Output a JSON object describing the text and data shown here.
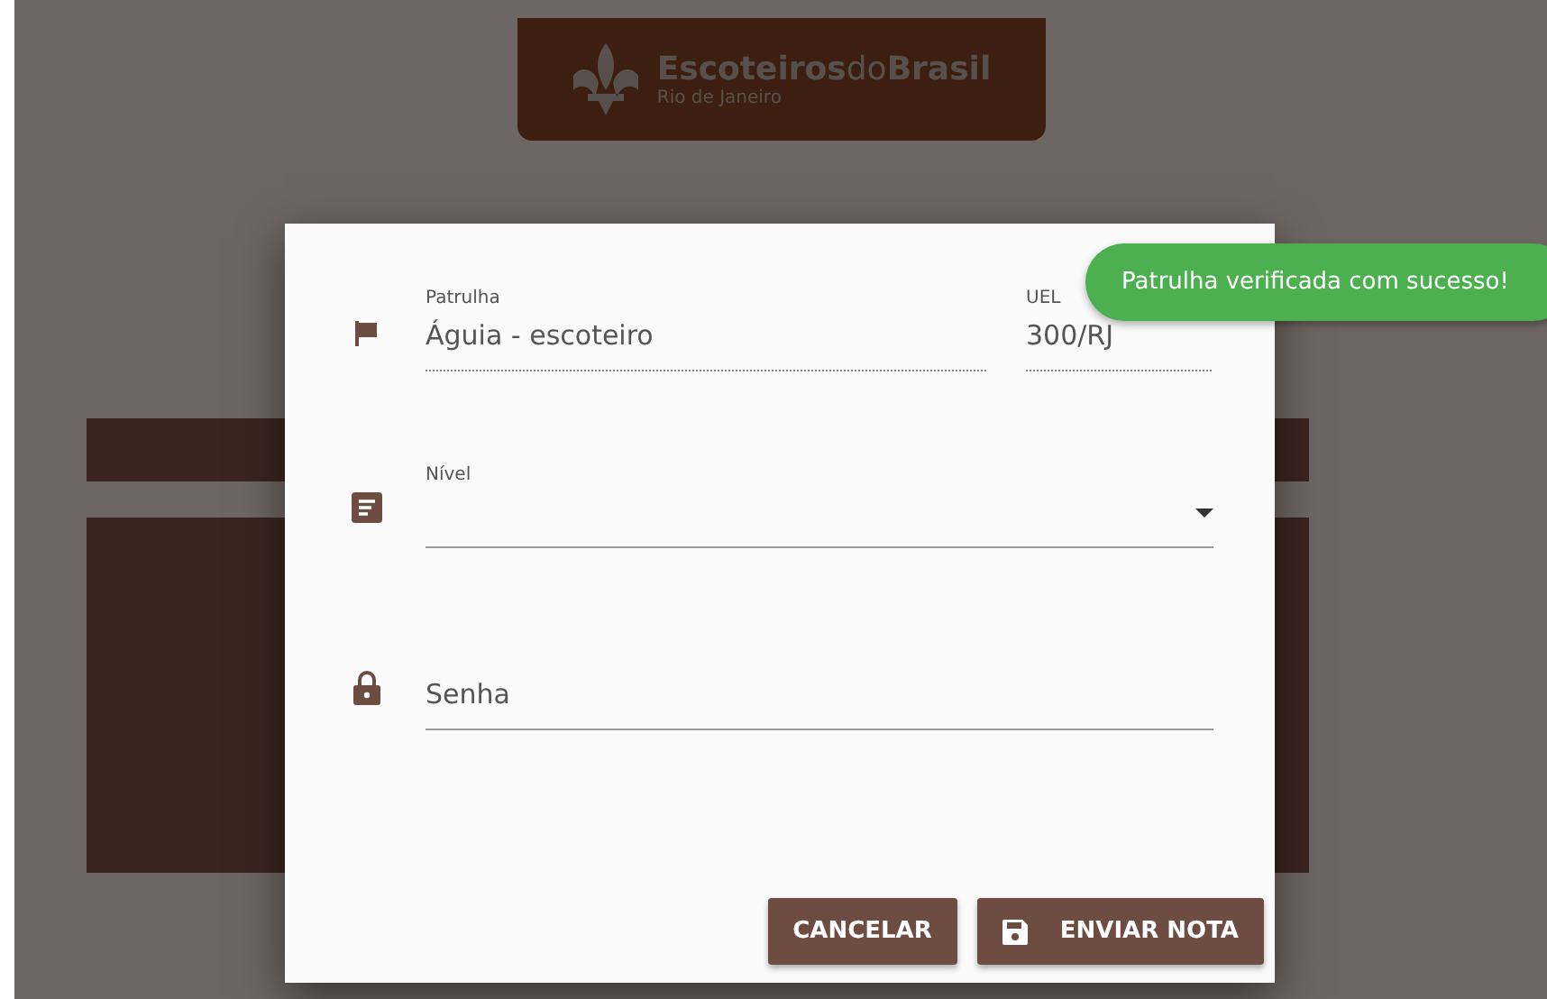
{
  "header": {
    "brand_strong_1": "Escoteiros",
    "brand_light": "do",
    "brand_strong_2": "Brasil",
    "region": "Rio de Janeiro"
  },
  "dialog": {
    "fields": [
      {
        "kind": "readonly",
        "label": "Patrulha",
        "value": "Águia - escoteiro"
      },
      {
        "kind": "readonly",
        "label": "UEL",
        "value": "300/RJ"
      },
      {
        "kind": "select",
        "label": "Nível"
      },
      {
        "kind": "password",
        "placeholder": "Senha"
      }
    ],
    "buttons": [
      {
        "kind": "cancel",
        "label": "CANCELAR"
      },
      {
        "kind": "submit",
        "label": "ENVIAR NOTA"
      }
    ]
  },
  "snackbar": {
    "message": "Patrulha verificada com sucesso!"
  }
}
